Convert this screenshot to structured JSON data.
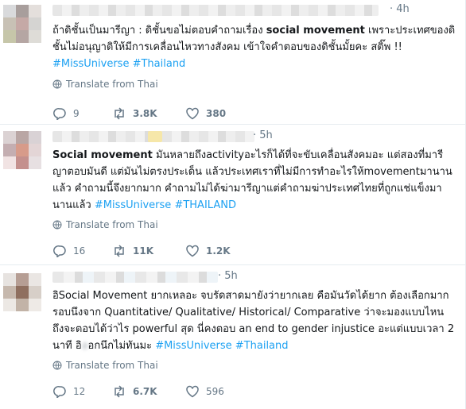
{
  "colors": {
    "link": "#1da1f2",
    "meta": "#657786",
    "divider": "#e6ecf0"
  },
  "icons": [
    "reply-icon",
    "retweet-icon",
    "like-icon",
    "globe-icon"
  ],
  "tweets": [
    {
      "time": "· 4h",
      "segments": [
        "ถ้าดิชั้นเป็นมารีญา : ดิชั้นขอไม่ตอบคำถามเรื่อง ",
        "social movement",
        " เพราะประเทศของดิชั้นไม่อนุญาติให้มีการเคลื่อนไหวทางสังคม เข้าใจคำตอบของดิชั้นมั้ยคะ สติ๊พ !! "
      ],
      "hashtags": [
        "#MissUniverse",
        "#Thailand"
      ],
      "translate": "Translate from Thai",
      "reply_count": "9",
      "retweet_count": "3.8K",
      "like_count": "380"
    },
    {
      "time": "· 5h",
      "segments": [
        "Social movement",
        " มันหลายถึงactivityอะไรก็ได้ที่จะขับเคลื่อนสังคมอะ แต่สองที่มารีญาตอบมันดี แต่มันไม่ตรงประเด็น แล้วประเทศเราที่ไม่มีการทำอะไรให้movementมานานแล้ว คำถามนี้จึงยากมาก คำถามไม่ได้ฆ่ามารีญาแต่คำถามฆ่าประเทศไทยที่ถูกแช่แข็งมานานแล้ว "
      ],
      "hashtags": [
        "#MissUniverse",
        "#THAILAND"
      ],
      "translate": "Translate from Thai",
      "reply_count": "16",
      "retweet_count": "11K",
      "like_count": "1.2K"
    },
    {
      "time": "· 5h",
      "text": "อิSocial Movement ยากเหลอะ จบรัดสาดมายังว่ายากเลย คือมันวัดได้ยาก ต้องเลือกมากรอบนึงจาก Quantitative/ Qualitative/ Historical/ Comparative ว่าจะมองแบบไหน ถึงจะตอบได้ว่าไร powerful สุด นี่คงตอบ an end to gender injustice อะแต่แบบเวลา 2 นาที อิ",
      "blur_mark": "อ",
      "text_after": "อกนึกไม่ทันมะ ",
      "hashtags": [
        "#MissUniverse",
        "#Thailand"
      ],
      "translate": "Translate from Thai",
      "reply_count": "12",
      "retweet_count": "6.7K",
      "like_count": "596"
    }
  ]
}
